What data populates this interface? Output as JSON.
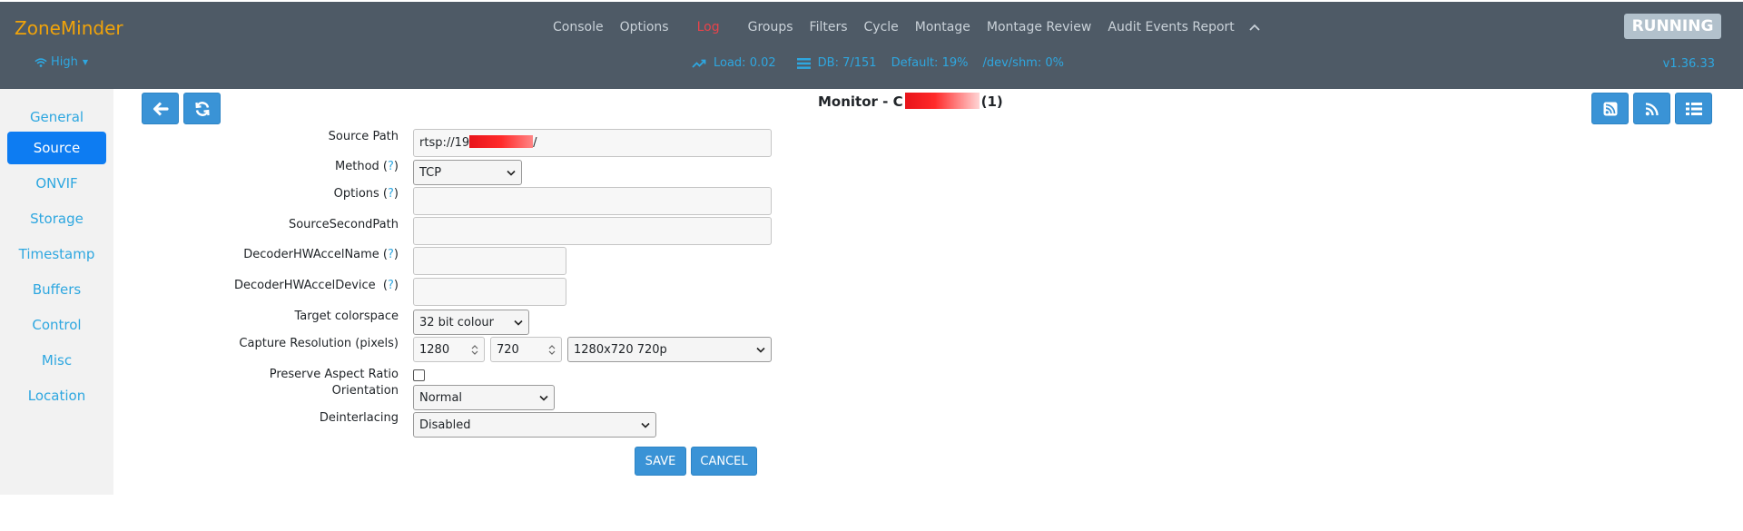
{
  "header": {
    "brand": "ZoneMinder",
    "bandwidth": "High",
    "menu": [
      "Console",
      "Options",
      "Log",
      "Groups",
      "Filters",
      "Cycle",
      "Montage",
      "Montage Review",
      "Audit Events Report"
    ],
    "active_menu": "Log",
    "status": {
      "load": "Load: 0.02",
      "db": "DB: 7/151",
      "default": "Default: 19%",
      "shm": "/dev/shm: 0%"
    },
    "running": "RUNNING",
    "version": "v1.36.33"
  },
  "sidebar": {
    "items": [
      "General",
      "Source",
      "ONVIF",
      "Storage",
      "Timestamp",
      "Buffers",
      "Control",
      "Misc",
      "Location"
    ],
    "active": "Source"
  },
  "page": {
    "title_prefix": "Monitor - C",
    "title_suffix": "(1)"
  },
  "form": {
    "source_path": {
      "label": "Source Path",
      "value_prefix": "rtsp://19",
      "value_suffix": "/"
    },
    "method": {
      "label": "Method",
      "help": "?",
      "value": "TCP"
    },
    "options": {
      "label": "Options",
      "help": "?",
      "value": ""
    },
    "source_second_path": {
      "label": "SourceSecondPath",
      "value": ""
    },
    "decoder_hw_accel_name": {
      "label": "DecoderHWAccelName",
      "help": "?",
      "value": ""
    },
    "decoder_hw_accel_device": {
      "label": "DecoderHWAccelDevice ",
      "help": "?",
      "value": ""
    },
    "target_colorspace": {
      "label": "Target colorspace",
      "value": "32 bit colour"
    },
    "capture_resolution": {
      "label": "Capture Resolution (pixels)",
      "width": "1280",
      "height": "720",
      "preset": "1280x720 720p"
    },
    "preserve_aspect_ratio": {
      "label": "Preserve Aspect Ratio",
      "checked": false
    },
    "orientation": {
      "label": "Orientation",
      "value": "Normal"
    },
    "deinterlacing": {
      "label": "Deinterlacing",
      "value": "Disabled"
    },
    "save_label": "SAVE",
    "cancel_label": "CANCEL"
  },
  "colors": {
    "navbar": "#4e5a66",
    "brand": "#f0a30a",
    "accent": "#2ea7e0",
    "active_log": "#e8434a",
    "button": "#3a93d6",
    "sidebar_active": "#0d7cf2"
  }
}
